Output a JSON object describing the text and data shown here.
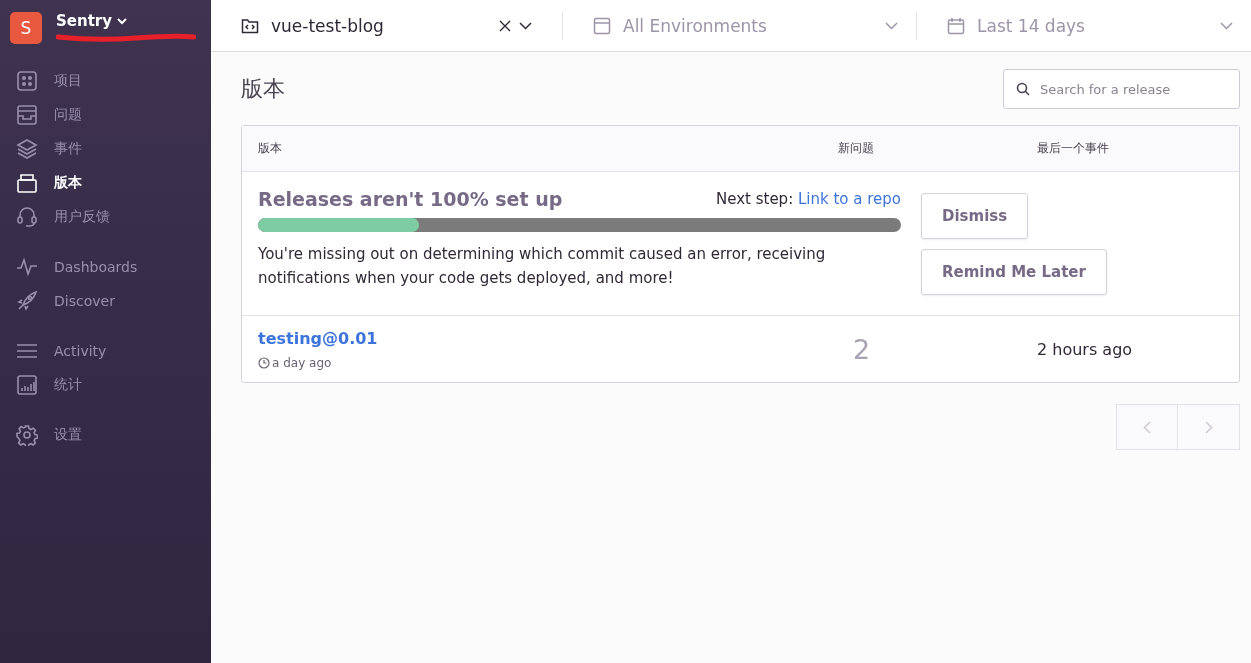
{
  "sidebar": {
    "org": {
      "initial": "S",
      "name": "Sentry"
    },
    "groups": [
      [
        {
          "label": "项目",
          "selected": false
        },
        {
          "label": "问题",
          "selected": false
        },
        {
          "label": "事件",
          "selected": false
        },
        {
          "label": "版本",
          "selected": true
        },
        {
          "label": "用户反馈",
          "selected": false
        }
      ],
      [
        {
          "label": "Dashboards",
          "selected": false
        },
        {
          "label": "Discover",
          "selected": false
        }
      ],
      [
        {
          "label": "Activity",
          "selected": false
        },
        {
          "label": "统计",
          "selected": false
        }
      ],
      [
        {
          "label": "设置",
          "selected": false
        }
      ]
    ]
  },
  "header": {
    "project": "vue-test-blog",
    "environment": "All Environments",
    "period": "Last 14 days"
  },
  "page": {
    "title": "版本",
    "search": {
      "placeholder": "Search for a release"
    }
  },
  "table": {
    "columns": [
      "版本",
      "新问题",
      "最后一个事件"
    ],
    "setup": {
      "title": "Releases aren't 100% set up",
      "next_label": "Next step:",
      "next_link": "Link to a repo",
      "level": 0.25,
      "text": "You're missing out on determining which commit caused an error, receiving notifications when your code gets deployed, and more!",
      "buttons": [
        "Dismiss",
        "Remind Me Later"
      ]
    },
    "rows": [
      {
        "version": "testing@0.01",
        "age": "a day ago",
        "new_issues": "2",
        "last_event": "2 hours ago"
      }
    ]
  },
  "pagination": {
    "prev_disabled": true,
    "next_disabled": true
  }
}
